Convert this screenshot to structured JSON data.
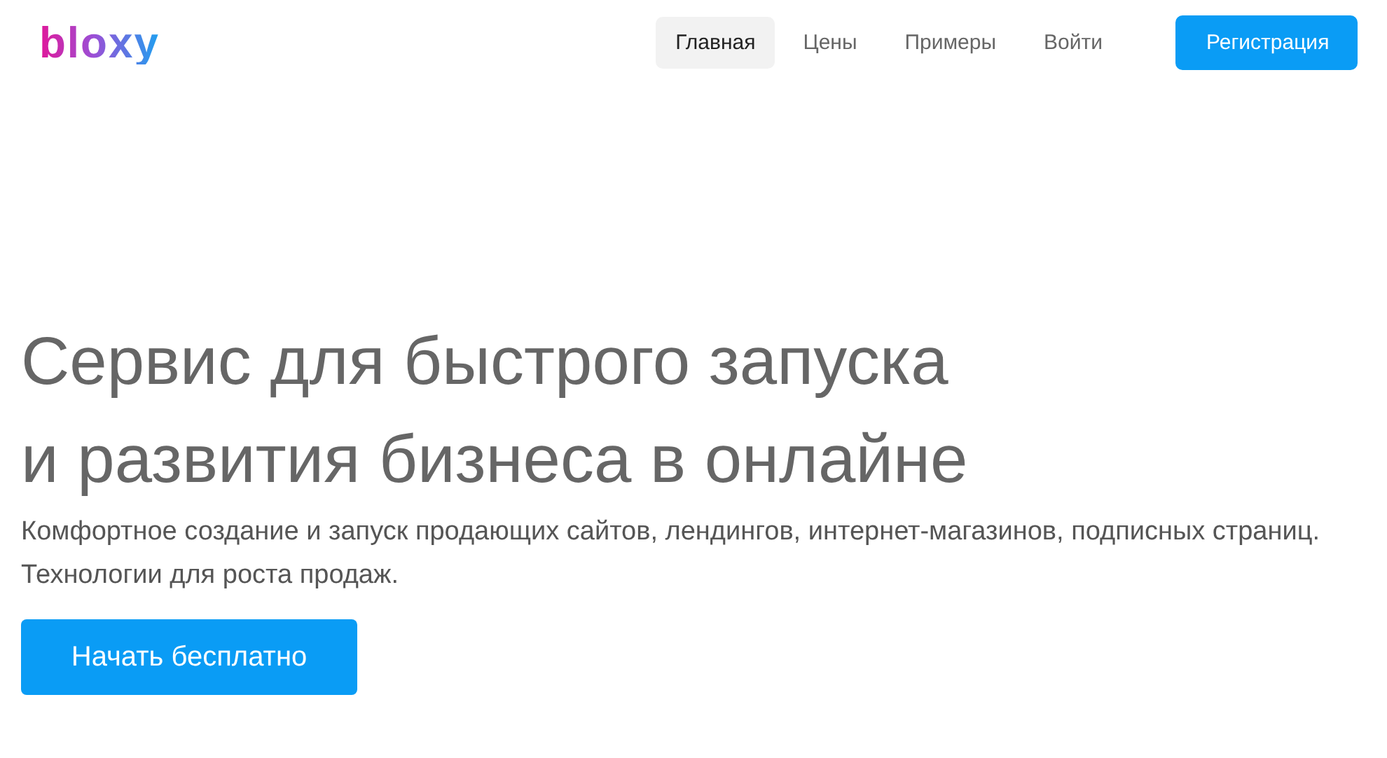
{
  "logo": {
    "text": "bloxy"
  },
  "nav": [
    {
      "label": "Главная",
      "selected": true
    },
    {
      "label": "Цены",
      "selected": false
    },
    {
      "label": "Примеры",
      "selected": false
    },
    {
      "label": "Войти",
      "selected": false
    }
  ],
  "register_button": "Регистрация",
  "hero": {
    "title_lines": [
      "Сервис для быстрого запуска",
      "и развития бизнеса в онлайне"
    ],
    "description": [
      "Комфортное создание и запуск продающих сайтов, лендингов, интернет-магазинов, подписных страниц.",
      "Технологии для роста продаж."
    ],
    "cta": "Начать бесплатно"
  }
}
